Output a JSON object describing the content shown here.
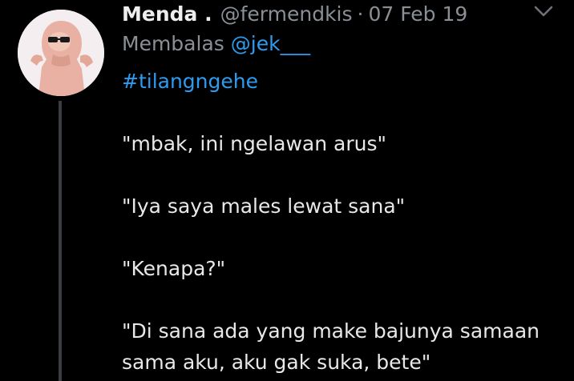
{
  "tweet": {
    "display_name": "Menda .",
    "handle": "@fermendkis",
    "separator": "·",
    "date": "07 Feb 19",
    "replying_prefix": "Membalas",
    "replying_to": "@jek___",
    "hashtag": "#tilangngehe",
    "lines": [
      "\"mbak, ini ngelawan arus\"",
      "\"Iya saya males lewat sana\"",
      "\"Kenapa?\"",
      "\"Di sana ada yang make bajunya samaan",
      "sama aku, aku gak suka, bete\""
    ]
  },
  "icons": {
    "menu": "chevron-down-icon"
  },
  "colors": {
    "background": "#000000",
    "link": "#2d9cf0",
    "secondary_text": "#8a8f95",
    "primary_text": "#e8e8e8",
    "thread_line": "#3a3d42"
  }
}
